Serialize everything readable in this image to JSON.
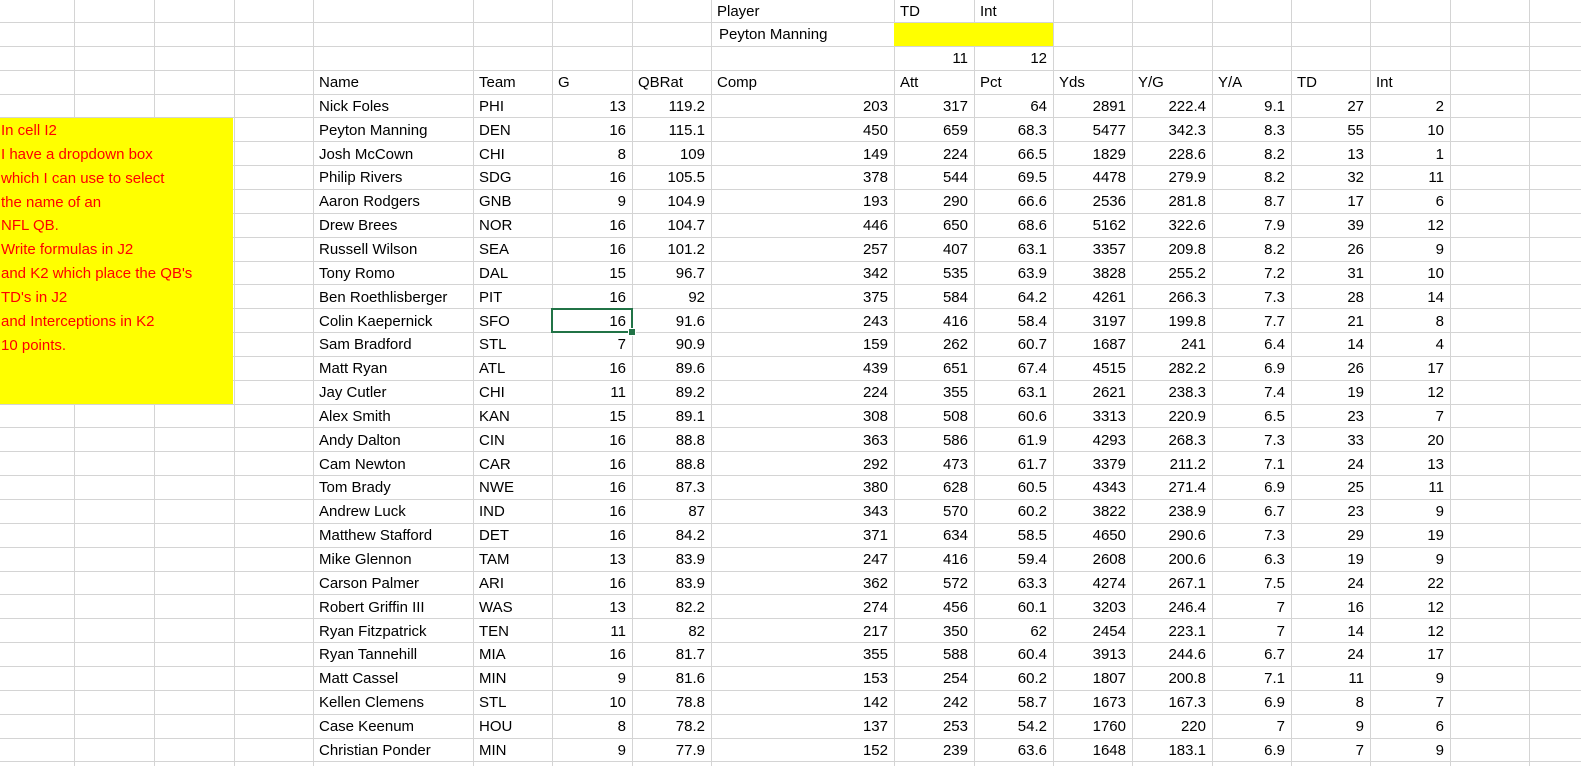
{
  "lookup": {
    "player_label": "Player",
    "td_label": "TD",
    "int_label": "Int",
    "selected_player": "Peyton Manning",
    "td_col_index": "11",
    "int_col_index": "12",
    "highlight_color": "#ffff00"
  },
  "note": {
    "lines": [
      "In cell I2",
      "I have a dropdown box",
      "which I can use to select",
      "the name of an",
      "NFL QB.",
      "Write formulas in J2",
      "and K2 which place the QB's",
      "TD's in J2",
      "and Interceptions in K2",
      "10 points."
    ],
    "text_color": "#ff0000",
    "background_color": "#ffff00"
  },
  "table": {
    "headers": [
      "Name",
      "Team",
      "G",
      "QBRat",
      "Comp",
      "Att",
      "Pct",
      "Yds",
      "Y/G",
      "Y/A",
      "TD",
      "Int"
    ],
    "rows": [
      [
        "Nick Foles",
        "PHI",
        "13",
        "119.2",
        "203",
        "317",
        "64",
        "2891",
        "222.4",
        "9.1",
        "27",
        "2"
      ],
      [
        "Peyton Manning",
        "DEN",
        "16",
        "115.1",
        "450",
        "659",
        "68.3",
        "5477",
        "342.3",
        "8.3",
        "55",
        "10"
      ],
      [
        "Josh McCown",
        "CHI",
        "8",
        "109",
        "149",
        "224",
        "66.5",
        "1829",
        "228.6",
        "8.2",
        "13",
        "1"
      ],
      [
        "Philip Rivers",
        "SDG",
        "16",
        "105.5",
        "378",
        "544",
        "69.5",
        "4478",
        "279.9",
        "8.2",
        "32",
        "11"
      ],
      [
        "Aaron Rodgers",
        "GNB",
        "9",
        "104.9",
        "193",
        "290",
        "66.6",
        "2536",
        "281.8",
        "8.7",
        "17",
        "6"
      ],
      [
        "Drew Brees",
        "NOR",
        "16",
        "104.7",
        "446",
        "650",
        "68.6",
        "5162",
        "322.6",
        "7.9",
        "39",
        "12"
      ],
      [
        "Russell Wilson",
        "SEA",
        "16",
        "101.2",
        "257",
        "407",
        "63.1",
        "3357",
        "209.8",
        "8.2",
        "26",
        "9"
      ],
      [
        "Tony Romo",
        "DAL",
        "15",
        "96.7",
        "342",
        "535",
        "63.9",
        "3828",
        "255.2",
        "7.2",
        "31",
        "10"
      ],
      [
        "Ben Roethlisberger",
        "PIT",
        "16",
        "92",
        "375",
        "584",
        "64.2",
        "4261",
        "266.3",
        "7.3",
        "28",
        "14"
      ],
      [
        "Colin Kaepernick",
        "SFO",
        "16",
        "91.6",
        "243",
        "416",
        "58.4",
        "3197",
        "199.8",
        "7.7",
        "21",
        "8"
      ],
      [
        "Sam Bradford",
        "STL",
        "7",
        "90.9",
        "159",
        "262",
        "60.7",
        "1687",
        "241",
        "6.4",
        "14",
        "4"
      ],
      [
        "Matt Ryan",
        "ATL",
        "16",
        "89.6",
        "439",
        "651",
        "67.4",
        "4515",
        "282.2",
        "6.9",
        "26",
        "17"
      ],
      [
        "Jay Cutler",
        "CHI",
        "11",
        "89.2",
        "224",
        "355",
        "63.1",
        "2621",
        "238.3",
        "7.4",
        "19",
        "12"
      ],
      [
        "Alex Smith",
        "KAN",
        "15",
        "89.1",
        "308",
        "508",
        "60.6",
        "3313",
        "220.9",
        "6.5",
        "23",
        "7"
      ],
      [
        "Andy Dalton",
        "CIN",
        "16",
        "88.8",
        "363",
        "586",
        "61.9",
        "4293",
        "268.3",
        "7.3",
        "33",
        "20"
      ],
      [
        "Cam Newton",
        "CAR",
        "16",
        "88.8",
        "292",
        "473",
        "61.7",
        "3379",
        "211.2",
        "7.1",
        "24",
        "13"
      ],
      [
        "Tom Brady",
        "NWE",
        "16",
        "87.3",
        "380",
        "628",
        "60.5",
        "4343",
        "271.4",
        "6.9",
        "25",
        "11"
      ],
      [
        "Andrew Luck",
        "IND",
        "16",
        "87",
        "343",
        "570",
        "60.2",
        "3822",
        "238.9",
        "6.7",
        "23",
        "9"
      ],
      [
        "Matthew Stafford",
        "DET",
        "16",
        "84.2",
        "371",
        "634",
        "58.5",
        "4650",
        "290.6",
        "7.3",
        "29",
        "19"
      ],
      [
        "Mike Glennon",
        "TAM",
        "13",
        "83.9",
        "247",
        "416",
        "59.4",
        "2608",
        "200.6",
        "6.3",
        "19",
        "9"
      ],
      [
        "Carson Palmer",
        "ARI",
        "16",
        "83.9",
        "362",
        "572",
        "63.3",
        "4274",
        "267.1",
        "7.5",
        "24",
        "22"
      ],
      [
        "Robert Griffin III",
        "WAS",
        "13",
        "82.2",
        "274",
        "456",
        "60.1",
        "3203",
        "246.4",
        "7",
        "16",
        "12"
      ],
      [
        "Ryan Fitzpatrick",
        "TEN",
        "11",
        "82",
        "217",
        "350",
        "62",
        "2454",
        "223.1",
        "7",
        "14",
        "12"
      ],
      [
        "Ryan Tannehill",
        "MIA",
        "16",
        "81.7",
        "355",
        "588",
        "60.4",
        "3913",
        "244.6",
        "6.7",
        "24",
        "17"
      ],
      [
        "Matt Cassel",
        "MIN",
        "9",
        "81.6",
        "153",
        "254",
        "60.2",
        "1807",
        "200.8",
        "7.1",
        "11",
        "9"
      ],
      [
        "Kellen Clemens",
        "STL",
        "10",
        "78.8",
        "142",
        "242",
        "58.7",
        "1673",
        "167.3",
        "6.9",
        "8",
        "7"
      ],
      [
        "Case Keenum",
        "HOU",
        "8",
        "78.2",
        "137",
        "253",
        "54.2",
        "1760",
        "220",
        "7",
        "9",
        "6"
      ],
      [
        "Christian Ponder",
        "MIN",
        "9",
        "77.9",
        "152",
        "239",
        "63.6",
        "1648",
        "183.1",
        "6.9",
        "7",
        "9"
      ]
    ],
    "selected_cell": {
      "row": 9,
      "col": 2,
      "value": "16"
    }
  }
}
